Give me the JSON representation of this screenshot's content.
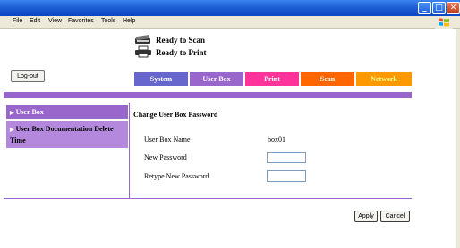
{
  "menubar": {
    "items": [
      "File",
      "Edit",
      "View",
      "Favorites",
      "Tools",
      "Help"
    ]
  },
  "window_controls": {
    "minimize": "minimize-icon",
    "maximize": "maximize-icon",
    "close": "close-icon"
  },
  "status": {
    "scan": "Ready to Scan",
    "print": "Ready to Print"
  },
  "header": {
    "logout_label": "Log-out"
  },
  "tabs": [
    {
      "label": "System",
      "color": "#6666cc",
      "text_color": "#ffffff"
    },
    {
      "label": "User Box",
      "color": "#9966cc",
      "text_color": "#ffffff"
    },
    {
      "label": "Print",
      "color": "#ff3399",
      "text_color": "#ffffff"
    },
    {
      "label": "Scan",
      "color": "#ff6600",
      "text_color": "#ffffff"
    },
    {
      "label": "Network",
      "color": "#ff9900",
      "text_color": "#ffff99"
    }
  ],
  "sidebar": {
    "items": [
      {
        "label": "User Box"
      },
      {
        "label": "User Box Documentation Delete Time"
      }
    ]
  },
  "main": {
    "title": "Change User Box Password",
    "fields": [
      {
        "label": "User Box Name",
        "value": "box01"
      },
      {
        "label": "New Password",
        "value": ""
      },
      {
        "label": "Retype New Password",
        "value": ""
      }
    ]
  },
  "buttons": {
    "apply": "Apply",
    "cancel": "Cancel"
  },
  "colors": {
    "accent_purple": "#9966cc",
    "sidebar_light": "#b388dd",
    "titlebar_blue": "#0a45c2"
  }
}
